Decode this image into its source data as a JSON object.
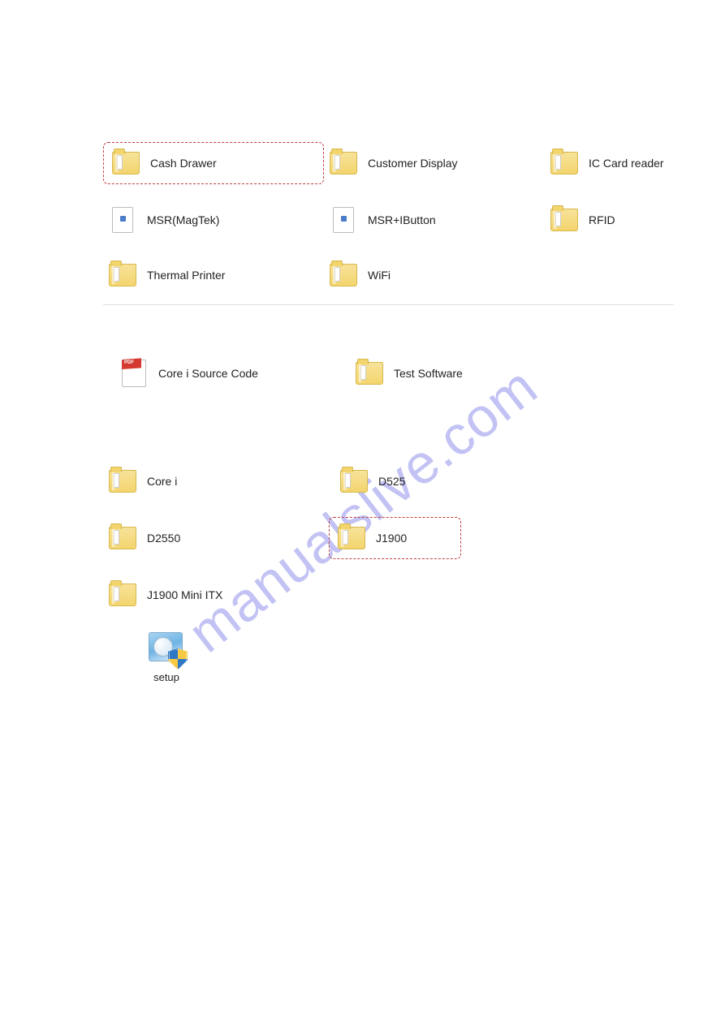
{
  "watermark": "manualslive.com",
  "panel1": {
    "row1": [
      {
        "label": "Cash Drawer",
        "highlighted": true
      },
      {
        "label": "Customer Display"
      },
      {
        "label": "IC Card reader"
      }
    ],
    "row2": [
      {
        "label": "MSR(MagTek)",
        "icon": "file"
      },
      {
        "label": "MSR+IButton",
        "icon": "file"
      },
      {
        "label": "RFID"
      }
    ],
    "row3": [
      {
        "label": "Thermal Printer"
      },
      {
        "label": "WiFi"
      }
    ]
  },
  "panel2": {
    "row1": [
      {
        "label": "Core i Source Code",
        "icon": "pdf"
      },
      {
        "label": "Test Software"
      }
    ]
  },
  "panel3": {
    "row1": [
      {
        "label": "Core i"
      },
      {
        "label": "D525"
      }
    ],
    "row2": [
      {
        "label": "D2550"
      },
      {
        "label": "J1900",
        "highlighted": true
      }
    ],
    "row3": [
      {
        "label": "J1900 Mini ITX"
      }
    ]
  },
  "setup": {
    "label": "setup"
  }
}
